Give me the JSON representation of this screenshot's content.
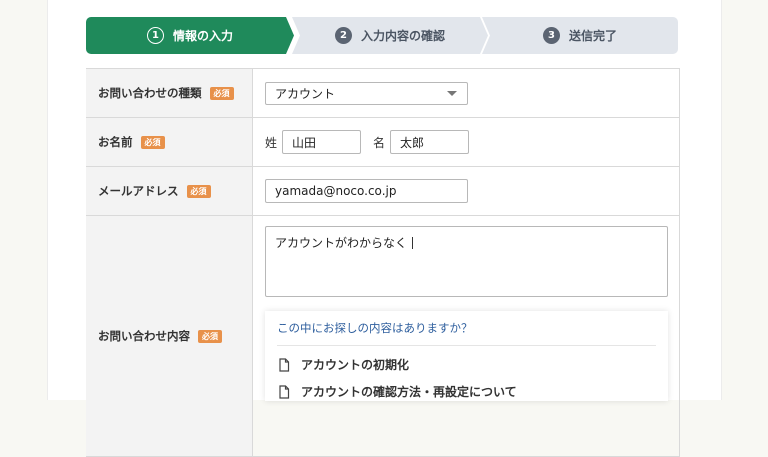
{
  "stepper": {
    "steps": [
      {
        "num": "1",
        "label": "情報の入力"
      },
      {
        "num": "2",
        "label": "入力内容の確認"
      },
      {
        "num": "3",
        "label": "送信完了"
      }
    ]
  },
  "colors": {
    "active_step": "#1f8a5b",
    "inactive_step": "#e2e6ec",
    "required_badge": "#e8914a",
    "suggest_title": "#2f5f9e"
  },
  "form": {
    "required_label": "必須",
    "type": {
      "label": "お問い合わせの種類",
      "value": "アカウント"
    },
    "name": {
      "label": "お名前",
      "last_label": "姓",
      "last_value": "山田",
      "first_label": "名",
      "first_value": "太郎"
    },
    "email": {
      "label": "メールアドレス",
      "value": "yamada@noco.co.jp"
    },
    "content": {
      "label": "お問い合わせ内容",
      "value": "アカウントがわからなく",
      "suggest": {
        "title": "この中にお探しの内容はありますか？",
        "items": [
          "アカウントの初期化",
          "アカウントの確認方法・再設定について"
        ]
      }
    }
  }
}
